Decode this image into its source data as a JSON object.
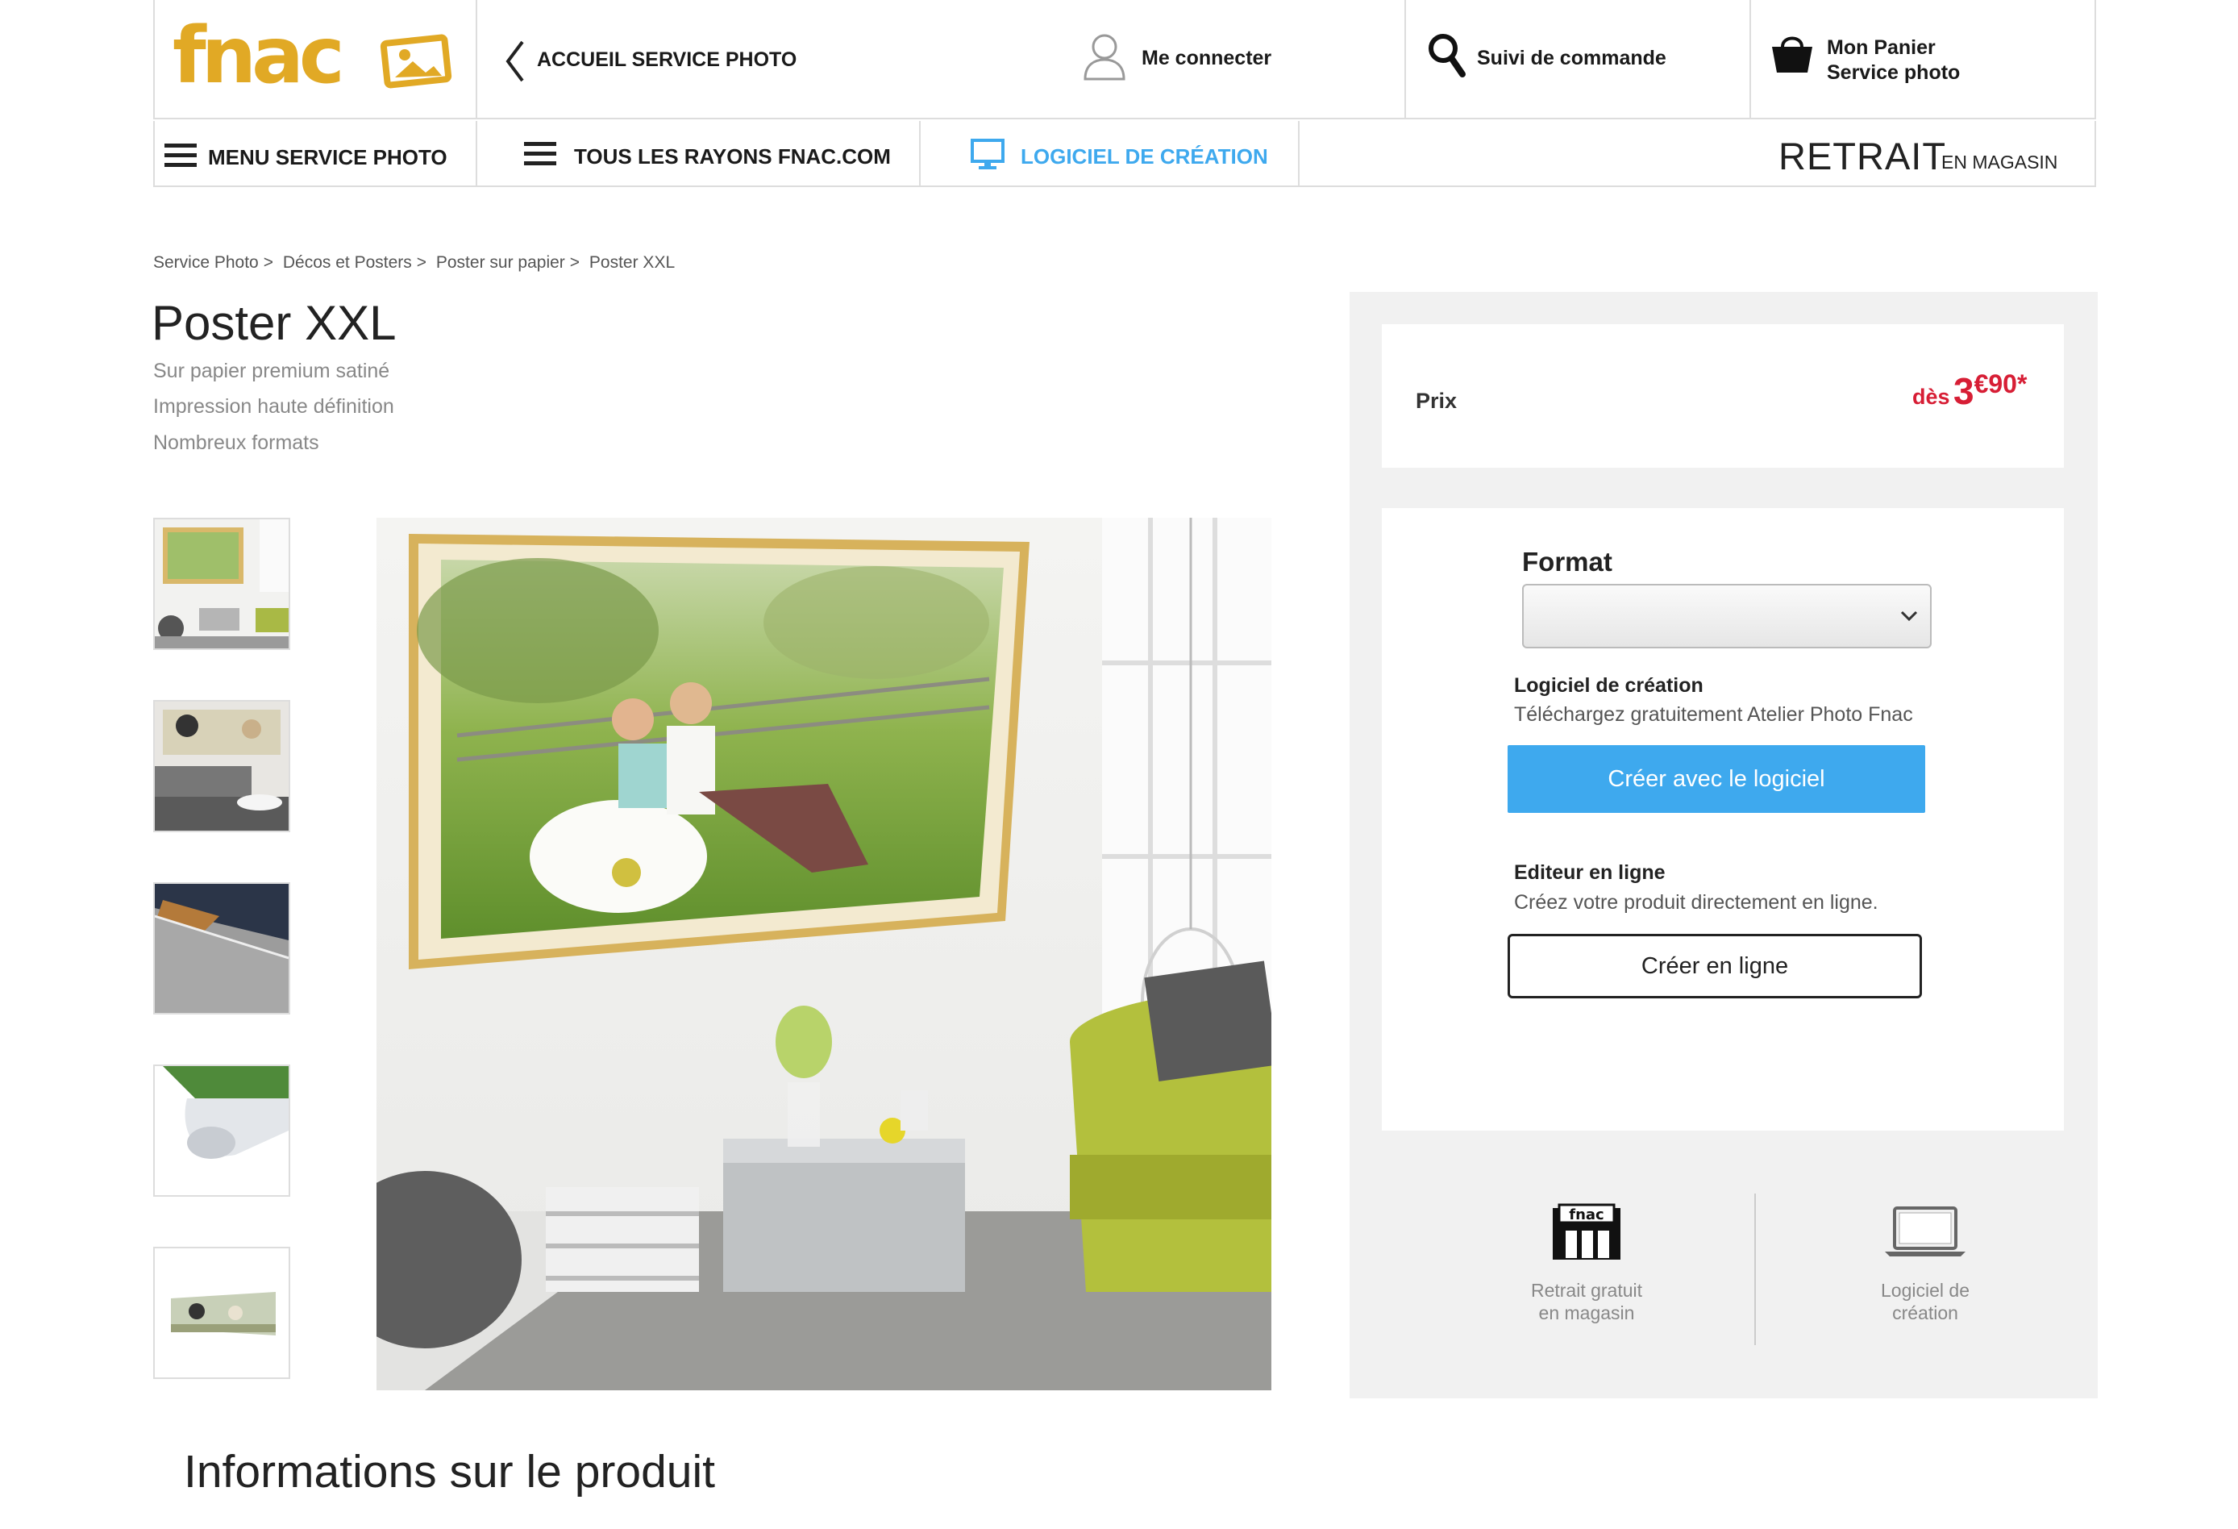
{
  "header": {
    "logo_text": "fnac",
    "back_label": "ACCUEIL SERVICE PHOTO",
    "login_label": "Me connecter",
    "tracking_label": "Suivi de commande",
    "cart_line1": "Mon Panier",
    "cart_line2": "Service photo"
  },
  "nav": {
    "menu_label": "MENU SERVICE PHOTO",
    "rayons_label": "TOUS LES RAYONS FNAC.COM",
    "logiciel_label": "LOGICIEL DE CRÉATION",
    "retrait_big": "RETRAIT",
    "retrait_small": "EN MAGASIN"
  },
  "colors": {
    "brand": "#e1a925",
    "accent": "#3ea9ee",
    "price": "#d71e35"
  },
  "breadcrumb": [
    {
      "label": "Service Photo",
      "sep": ">"
    },
    {
      "label": "Décos et Posters",
      "sep": ">"
    },
    {
      "label": "Poster sur papier",
      "sep": ">"
    },
    {
      "label": "Poster XXL",
      "sep": ""
    }
  ],
  "product": {
    "title": "Poster XXL",
    "features": [
      "Sur papier premium satiné",
      "Impression haute définition",
      "Nombreux formats"
    ]
  },
  "price": {
    "label": "Prix",
    "prefix": "dès",
    "euros": "3",
    "cents": "€90*"
  },
  "format": {
    "label": "Format",
    "selected": ""
  },
  "logiciel": {
    "title": "Logiciel de création",
    "subtitle": "Téléchargez gratuitement Atelier Photo Fnac",
    "button": "Créer avec le logiciel"
  },
  "editeur": {
    "title": "Editeur en ligne",
    "subtitle": "Créez votre produit directement en ligne.",
    "button": "Créer en ligne"
  },
  "footer_icons": [
    {
      "line1": "Retrait gratuit",
      "line2": "en magasin",
      "icon": "store-icon",
      "store_text": "fnac"
    },
    {
      "line1": "Logiciel de",
      "line2": "création",
      "icon": "laptop-icon"
    }
  ],
  "info_title": "Informations sur le produit"
}
